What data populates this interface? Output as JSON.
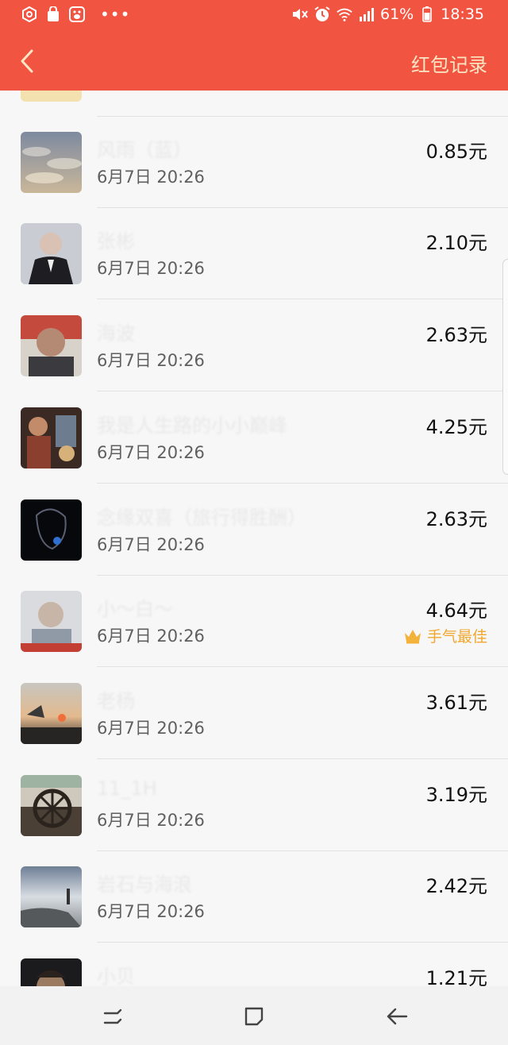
{
  "status_bar": {
    "battery": "61%",
    "time": "18:35",
    "icons_left": [
      "settings-hex-icon",
      "bag-icon",
      "baidu-icon",
      "more-dots-icon"
    ],
    "icons_right": [
      "mute-icon",
      "alarm-icon",
      "wifi-icon",
      "signal-icon",
      "battery-icon"
    ]
  },
  "header": {
    "back_icon": "chevron-left-icon",
    "title": "红包记录"
  },
  "colors": {
    "accent": "#f25442",
    "title_text": "#fde6c4",
    "best_luck": "#f0a830"
  },
  "records": [
    {
      "name": "风雨（蓝）",
      "time": "6月7日  20:26",
      "amount": "0.85元",
      "best": ""
    },
    {
      "name": "张彬",
      "time": "6月7日  20:26",
      "amount": "2.10元",
      "best": ""
    },
    {
      "name": "海波",
      "time": "6月7日  20:26",
      "amount": "2.63元",
      "best": ""
    },
    {
      "name": "我是人生路的小小巅峰",
      "time": "6月7日  20:26",
      "amount": "4.25元",
      "best": ""
    },
    {
      "name": "念缘双喜（旅行得胜酬）",
      "time": "6月7日  20:26",
      "amount": "2.63元",
      "best": ""
    },
    {
      "name": "小～白～",
      "time": "6月7日  20:26",
      "amount": "4.64元",
      "best": "手气最佳"
    },
    {
      "name": "老杨",
      "time": "6月7日  20:26",
      "amount": "3.61元",
      "best": ""
    },
    {
      "name": "11_1H",
      "time": "6月7日  20:26",
      "amount": "3.19元",
      "best": ""
    },
    {
      "name": "岩石与海浪",
      "time": "6月7日  20:26",
      "amount": "2.42元",
      "best": ""
    },
    {
      "name": "小贝",
      "time": "",
      "amount": "1.21元",
      "best": ""
    }
  ],
  "bottom_nav": [
    "recent-apps-icon",
    "home-icon",
    "back-arrow-icon"
  ]
}
